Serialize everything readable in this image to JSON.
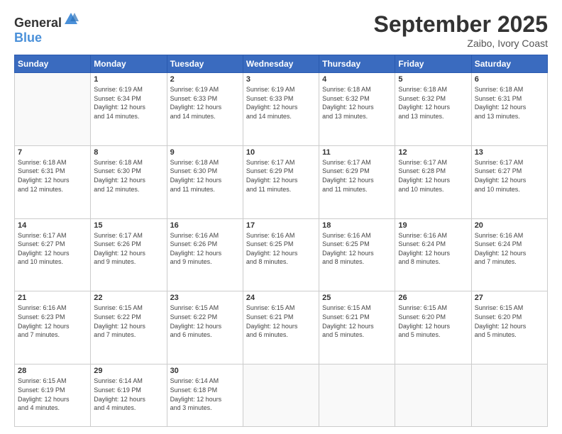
{
  "logo": {
    "general": "General",
    "blue": "Blue"
  },
  "header": {
    "month": "September 2025",
    "location": "Zaibo, Ivory Coast"
  },
  "days_of_week": [
    "Sunday",
    "Monday",
    "Tuesday",
    "Wednesday",
    "Thursday",
    "Friday",
    "Saturday"
  ],
  "weeks": [
    [
      {
        "day": "",
        "detail": ""
      },
      {
        "day": "1",
        "detail": "Sunrise: 6:19 AM\nSunset: 6:34 PM\nDaylight: 12 hours\nand 14 minutes."
      },
      {
        "day": "2",
        "detail": "Sunrise: 6:19 AM\nSunset: 6:33 PM\nDaylight: 12 hours\nand 14 minutes."
      },
      {
        "day": "3",
        "detail": "Sunrise: 6:19 AM\nSunset: 6:33 PM\nDaylight: 12 hours\nand 14 minutes."
      },
      {
        "day": "4",
        "detail": "Sunrise: 6:18 AM\nSunset: 6:32 PM\nDaylight: 12 hours\nand 13 minutes."
      },
      {
        "day": "5",
        "detail": "Sunrise: 6:18 AM\nSunset: 6:32 PM\nDaylight: 12 hours\nand 13 minutes."
      },
      {
        "day": "6",
        "detail": "Sunrise: 6:18 AM\nSunset: 6:31 PM\nDaylight: 12 hours\nand 13 minutes."
      }
    ],
    [
      {
        "day": "7",
        "detail": "Sunrise: 6:18 AM\nSunset: 6:31 PM\nDaylight: 12 hours\nand 12 minutes."
      },
      {
        "day": "8",
        "detail": "Sunrise: 6:18 AM\nSunset: 6:30 PM\nDaylight: 12 hours\nand 12 minutes."
      },
      {
        "day": "9",
        "detail": "Sunrise: 6:18 AM\nSunset: 6:30 PM\nDaylight: 12 hours\nand 11 minutes."
      },
      {
        "day": "10",
        "detail": "Sunrise: 6:17 AM\nSunset: 6:29 PM\nDaylight: 12 hours\nand 11 minutes."
      },
      {
        "day": "11",
        "detail": "Sunrise: 6:17 AM\nSunset: 6:29 PM\nDaylight: 12 hours\nand 11 minutes."
      },
      {
        "day": "12",
        "detail": "Sunrise: 6:17 AM\nSunset: 6:28 PM\nDaylight: 12 hours\nand 10 minutes."
      },
      {
        "day": "13",
        "detail": "Sunrise: 6:17 AM\nSunset: 6:27 PM\nDaylight: 12 hours\nand 10 minutes."
      }
    ],
    [
      {
        "day": "14",
        "detail": "Sunrise: 6:17 AM\nSunset: 6:27 PM\nDaylight: 12 hours\nand 10 minutes."
      },
      {
        "day": "15",
        "detail": "Sunrise: 6:17 AM\nSunset: 6:26 PM\nDaylight: 12 hours\nand 9 minutes."
      },
      {
        "day": "16",
        "detail": "Sunrise: 6:16 AM\nSunset: 6:26 PM\nDaylight: 12 hours\nand 9 minutes."
      },
      {
        "day": "17",
        "detail": "Sunrise: 6:16 AM\nSunset: 6:25 PM\nDaylight: 12 hours\nand 8 minutes."
      },
      {
        "day": "18",
        "detail": "Sunrise: 6:16 AM\nSunset: 6:25 PM\nDaylight: 12 hours\nand 8 minutes."
      },
      {
        "day": "19",
        "detail": "Sunrise: 6:16 AM\nSunset: 6:24 PM\nDaylight: 12 hours\nand 8 minutes."
      },
      {
        "day": "20",
        "detail": "Sunrise: 6:16 AM\nSunset: 6:24 PM\nDaylight: 12 hours\nand 7 minutes."
      }
    ],
    [
      {
        "day": "21",
        "detail": "Sunrise: 6:16 AM\nSunset: 6:23 PM\nDaylight: 12 hours\nand 7 minutes."
      },
      {
        "day": "22",
        "detail": "Sunrise: 6:15 AM\nSunset: 6:22 PM\nDaylight: 12 hours\nand 7 minutes."
      },
      {
        "day": "23",
        "detail": "Sunrise: 6:15 AM\nSunset: 6:22 PM\nDaylight: 12 hours\nand 6 minutes."
      },
      {
        "day": "24",
        "detail": "Sunrise: 6:15 AM\nSunset: 6:21 PM\nDaylight: 12 hours\nand 6 minutes."
      },
      {
        "day": "25",
        "detail": "Sunrise: 6:15 AM\nSunset: 6:21 PM\nDaylight: 12 hours\nand 5 minutes."
      },
      {
        "day": "26",
        "detail": "Sunrise: 6:15 AM\nSunset: 6:20 PM\nDaylight: 12 hours\nand 5 minutes."
      },
      {
        "day": "27",
        "detail": "Sunrise: 6:15 AM\nSunset: 6:20 PM\nDaylight: 12 hours\nand 5 minutes."
      }
    ],
    [
      {
        "day": "28",
        "detail": "Sunrise: 6:15 AM\nSunset: 6:19 PM\nDaylight: 12 hours\nand 4 minutes."
      },
      {
        "day": "29",
        "detail": "Sunrise: 6:14 AM\nSunset: 6:19 PM\nDaylight: 12 hours\nand 4 minutes."
      },
      {
        "day": "30",
        "detail": "Sunrise: 6:14 AM\nSunset: 6:18 PM\nDaylight: 12 hours\nand 3 minutes."
      },
      {
        "day": "",
        "detail": ""
      },
      {
        "day": "",
        "detail": ""
      },
      {
        "day": "",
        "detail": ""
      },
      {
        "day": "",
        "detail": ""
      }
    ]
  ]
}
